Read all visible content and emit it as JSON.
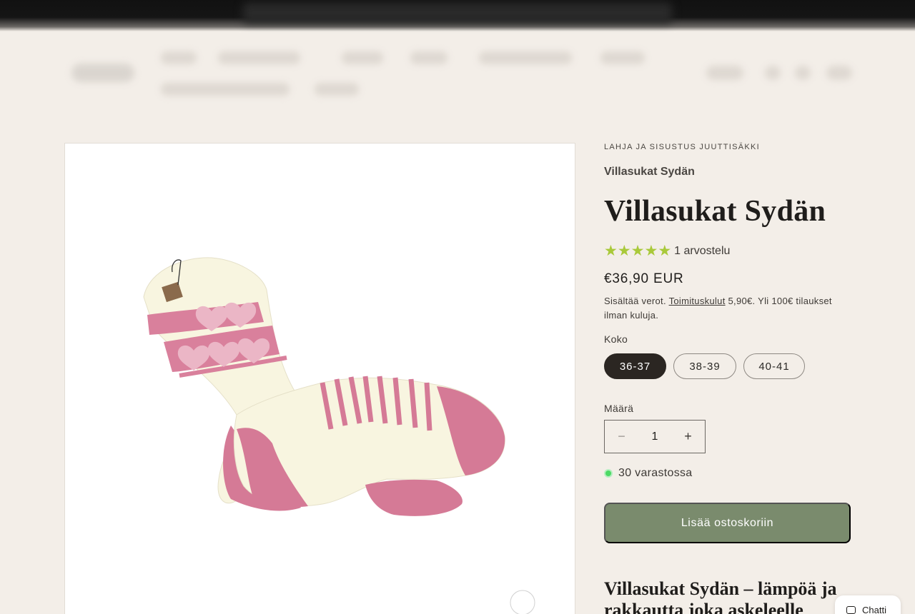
{
  "header": {
    "logo_text": "",
    "nav": [
      "",
      "",
      "",
      "",
      "",
      "",
      ""
    ]
  },
  "product": {
    "vendor": "LAHJA JA SISUSTUS JUUTTISÄKKI",
    "subtitle": "Villasukat Sydän",
    "title": "Villasukat Sydän",
    "rating": {
      "stars": 5,
      "max": 5,
      "count_label": "1 arvostelu",
      "star_color": "#a9c93a"
    },
    "price": "€36,90 EUR",
    "tax_note_1": "Sisältää verot. ",
    "tax_note_link": "Toimituskulut",
    "tax_note_2": " 5,90€. Yli 100€ tilaukset ilman kuluja.",
    "size_label": "Koko",
    "sizes": [
      "36-37",
      "38-39",
      "40-41"
    ],
    "selected_size": "36-37",
    "quantity_label": "Määrä",
    "quantity": "1",
    "stock_text": "30 varastossa",
    "add_to_cart": "Lisää ostoskoriin",
    "description_heading": "Villasukat Sydän – lämpöä ja rakkautta joka askeleelle"
  },
  "chat": {
    "label": "Chatti"
  },
  "icons": {
    "minus": "minus-icon",
    "plus": "plus-icon",
    "chat": "chat-bubble-icon",
    "star": "star-icon"
  },
  "colors": {
    "background": "#f3eee8",
    "button": "#7a8b6d",
    "selected_pill": "#2b2622",
    "stock_dot": "#4cd964"
  }
}
